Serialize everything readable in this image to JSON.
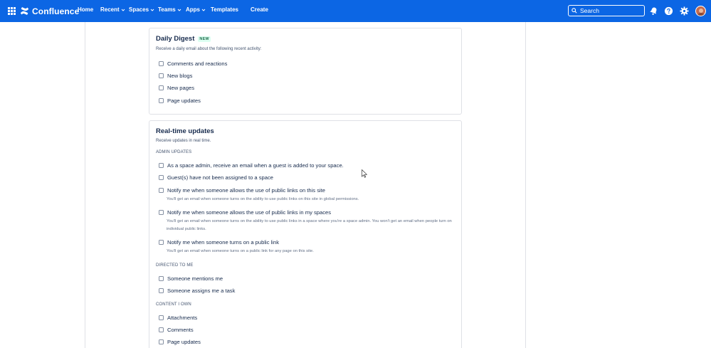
{
  "nav": {
    "logo_text": "Confluence",
    "items": [
      {
        "label": "Home",
        "dropdown": false
      },
      {
        "label": "Recent",
        "dropdown": true
      },
      {
        "label": "Spaces",
        "dropdown": true
      },
      {
        "label": "Teams",
        "dropdown": true
      },
      {
        "label": "Apps",
        "dropdown": true
      },
      {
        "label": "Templates",
        "dropdown": false
      },
      {
        "label": "Create",
        "dropdown": false
      }
    ],
    "search_placeholder": "Search",
    "icons": [
      "notifications-icon",
      "help-icon",
      "settings-icon"
    ],
    "brand_color": "#0c66e4"
  },
  "daily_digest": {
    "title": "Daily Digest",
    "badge": "NEW",
    "description": "Receive a daily email about the following recent activity:",
    "options": [
      "Comments and reactions",
      "New blogs",
      "New pages",
      "Page updates"
    ]
  },
  "realtime": {
    "title": "Real-time updates",
    "description": "Receive updates in real time.",
    "admin_label": "ADMIN UPDATES",
    "admin_options": [
      {
        "label": "As a space admin, receive an email when a guest is added to your space.",
        "help": ""
      },
      {
        "label": "Guest(s) have not been assigned to a space",
        "help": ""
      },
      {
        "label": "Notify me when someone allows the use of public links on this site",
        "help": "You'll get an email when someone turns on the ability to use public links on this site in global permissions."
      },
      {
        "label": "Notify me when someone allows the use of public links in my spaces",
        "help": "You'll get an email when someone turns on the ability to use public links in a space where you're a space admin. You won't get an email when people turn on individual public links."
      },
      {
        "label": "Notify me when someone turns on a public link",
        "help": "You'll get an email when someone turns on a public link for any page on this site."
      }
    ],
    "directed_label": "DIRECTED TO ME",
    "directed_options": [
      "Someone mentions me",
      "Someone assigns me a task"
    ],
    "content_label": "CONTENT I OWN",
    "content_options": [
      "Attachments",
      "Comments",
      "Page updates"
    ]
  }
}
